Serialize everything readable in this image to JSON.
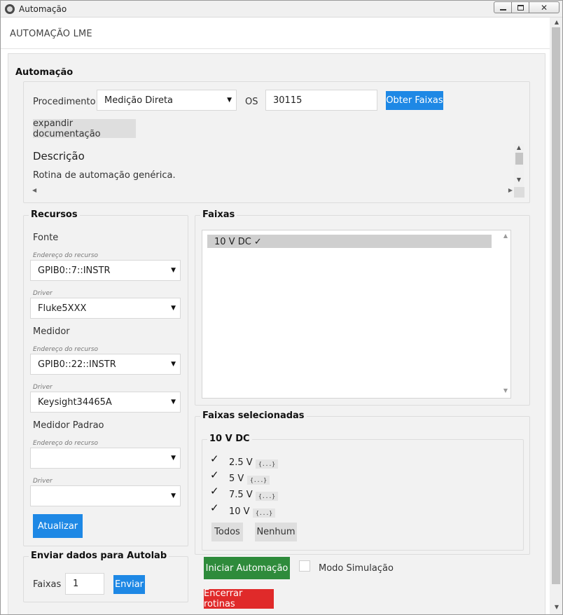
{
  "window": {
    "title": "Automação"
  },
  "header": {
    "title": "AUTOMAÇÃO LME"
  },
  "automacao": {
    "section_title": "Automação",
    "procedimento_label": "Procedimento",
    "procedimento_value": "Medição Direta",
    "os_label": "OS",
    "os_value": "30115",
    "obter_faixas_label": "Obter Faixas",
    "expandir_label": "expandir documentação",
    "descricao_title": "Descrição",
    "descricao_text": "Rotina de automação genérica."
  },
  "recursos": {
    "section_title": "Recursos",
    "fonte": {
      "title": "Fonte",
      "endereco_label": "Endereço do recurso",
      "endereco_value": "GPIB0::7::INSTR",
      "driver_label": "Driver",
      "driver_value": "Fluke5XXX"
    },
    "medidor": {
      "title": "Medidor",
      "endereco_label": "Endereço do recurso",
      "endereco_value": "GPIB0::22::INSTR",
      "driver_label": "Driver",
      "driver_value": "Keysight34465A"
    },
    "medidor_padrao": {
      "title": "Medidor Padrao",
      "endereco_label": "Endereço do recurso",
      "endereco_value": "",
      "driver_label": "Driver",
      "driver_value": ""
    },
    "atualizar_label": "Atualizar"
  },
  "enviar": {
    "section_title": "Enviar dados para Autolab",
    "faixas_label": "Faixas",
    "faixas_value": "1",
    "enviar_label": "Enviar"
  },
  "faixas": {
    "section_title": "Faixas",
    "items": [
      "10 V DC ✓"
    ]
  },
  "faixas_selecionadas": {
    "section_title": "Faixas selecionadas",
    "group_title": "10 V DC",
    "options": [
      {
        "label": "2.5 V",
        "chip": "{...}",
        "checked": true
      },
      {
        "label": "5 V",
        "chip": "{...}",
        "checked": true
      },
      {
        "label": "7.5 V",
        "chip": "{...}",
        "checked": true
      },
      {
        "label": "10 V",
        "chip": "{...}",
        "checked": true
      }
    ],
    "todos_label": "Todos",
    "nenhum_label": "Nenhum"
  },
  "actions": {
    "iniciar_label": "Iniciar Automação",
    "modo_simulacao_label": "Modo Simulação",
    "encerrar_label": "Encerrar rotinas"
  },
  "colors": {
    "primary": "#1e88e5",
    "success": "#2e8b3b",
    "danger": "#e02a2a"
  }
}
